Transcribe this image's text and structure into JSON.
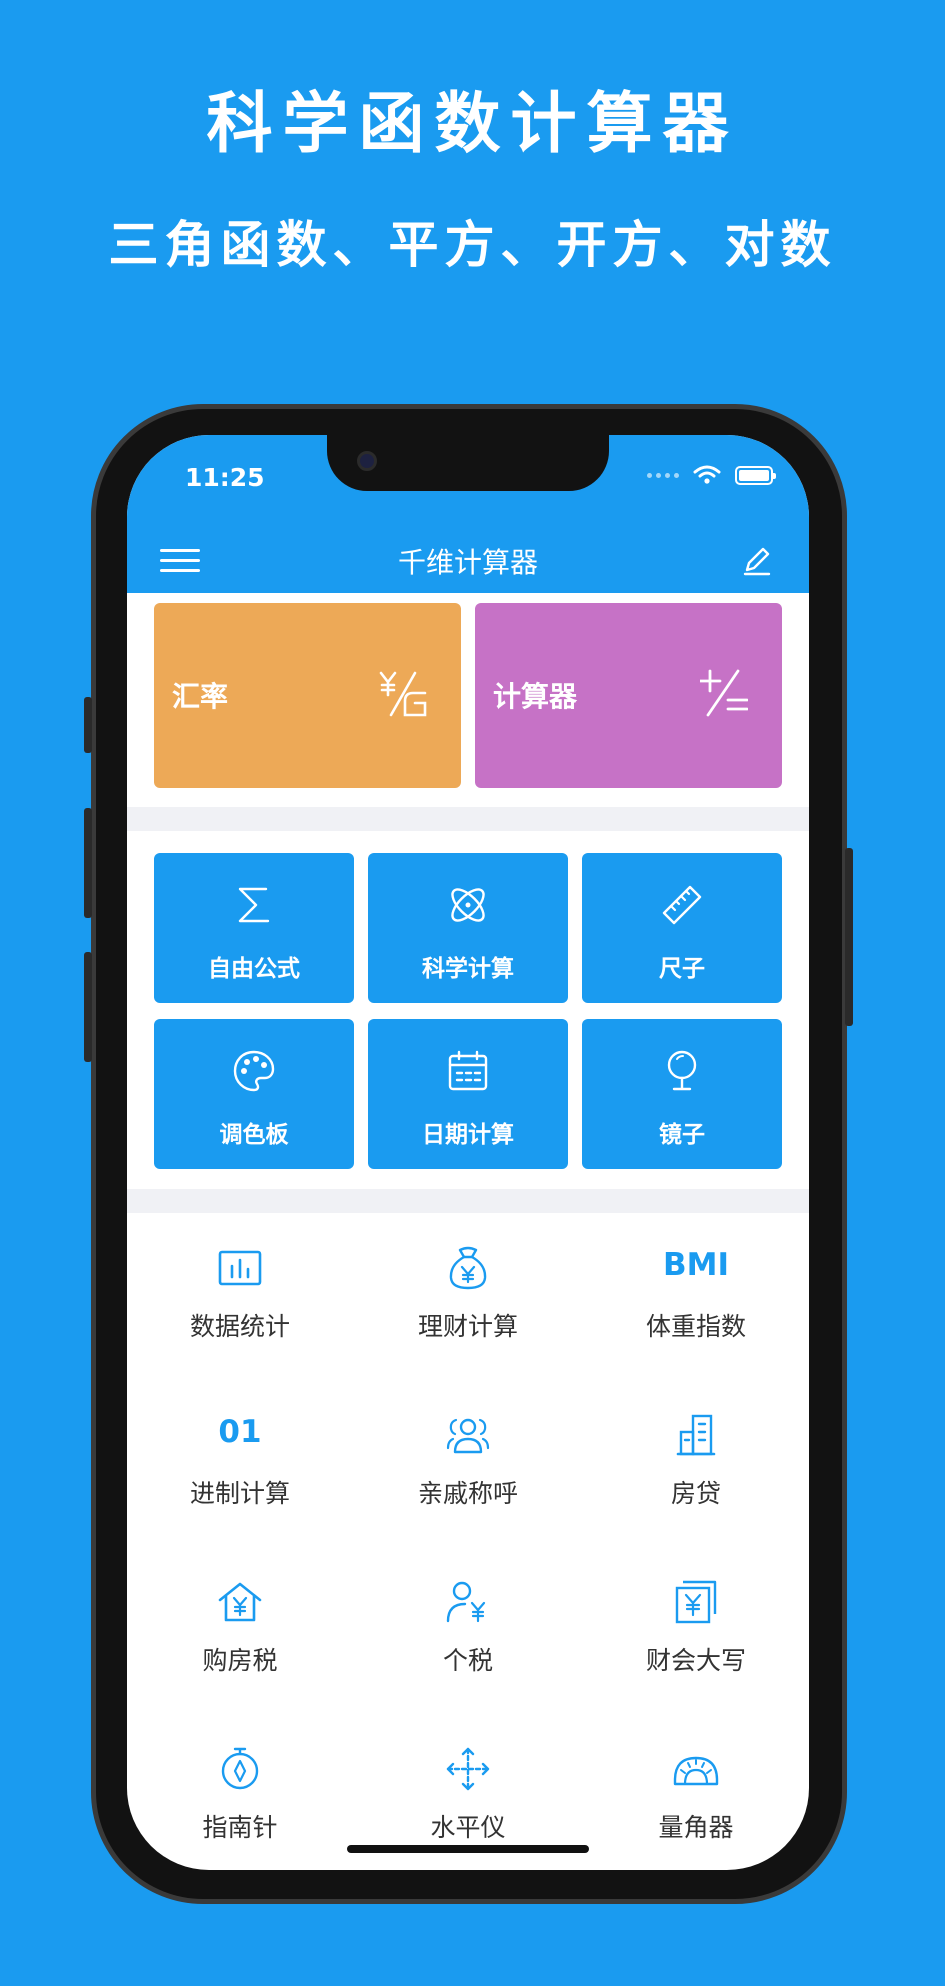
{
  "promo": {
    "title": "科学函数计算器",
    "subtitle": "三角函数、平方、开方、对数"
  },
  "status_bar": {
    "time": "11:25"
  },
  "navbar": {
    "title": "千维计算器",
    "menu_icon": "menu-icon",
    "edit_icon": "edit-icon"
  },
  "colors": {
    "primary": "#1a9bf0",
    "exchange_card": "#eda957",
    "calculator_card": "#c672c6",
    "label_text": "#333333"
  },
  "big_cards": [
    {
      "label": "汇率",
      "icon": "currency-exchange-icon"
    },
    {
      "label": "计算器",
      "icon": "plus-equals-icon"
    }
  ],
  "tiles": [
    {
      "label": "自由公式",
      "icon": "sigma-icon"
    },
    {
      "label": "科学计算",
      "icon": "atom-icon"
    },
    {
      "label": "尺子",
      "icon": "ruler-icon"
    },
    {
      "label": "调色板",
      "icon": "palette-icon"
    },
    {
      "label": "日期计算",
      "icon": "calendar-icon"
    },
    {
      "label": "镜子",
      "icon": "mirror-icon"
    }
  ],
  "grid": [
    {
      "label": "数据统计",
      "icon": "bar-chart-icon"
    },
    {
      "label": "理财计算",
      "icon": "money-bag-icon"
    },
    {
      "label": "体重指数",
      "icon_text": "BMI"
    },
    {
      "label": "进制计算",
      "icon_text": "01"
    },
    {
      "label": "亲戚称呼",
      "icon": "people-icon"
    },
    {
      "label": "房贷",
      "icon": "building-icon"
    },
    {
      "label": "购房税",
      "icon": "house-yen-icon"
    },
    {
      "label": "个税",
      "icon": "person-yen-icon"
    },
    {
      "label": "财会大写",
      "icon": "yen-document-icon"
    },
    {
      "label": "指南针",
      "icon": "compass-icon"
    },
    {
      "label": "水平仪",
      "icon": "level-arrows-icon"
    },
    {
      "label": "量角器",
      "icon": "protractor-icon"
    }
  ]
}
